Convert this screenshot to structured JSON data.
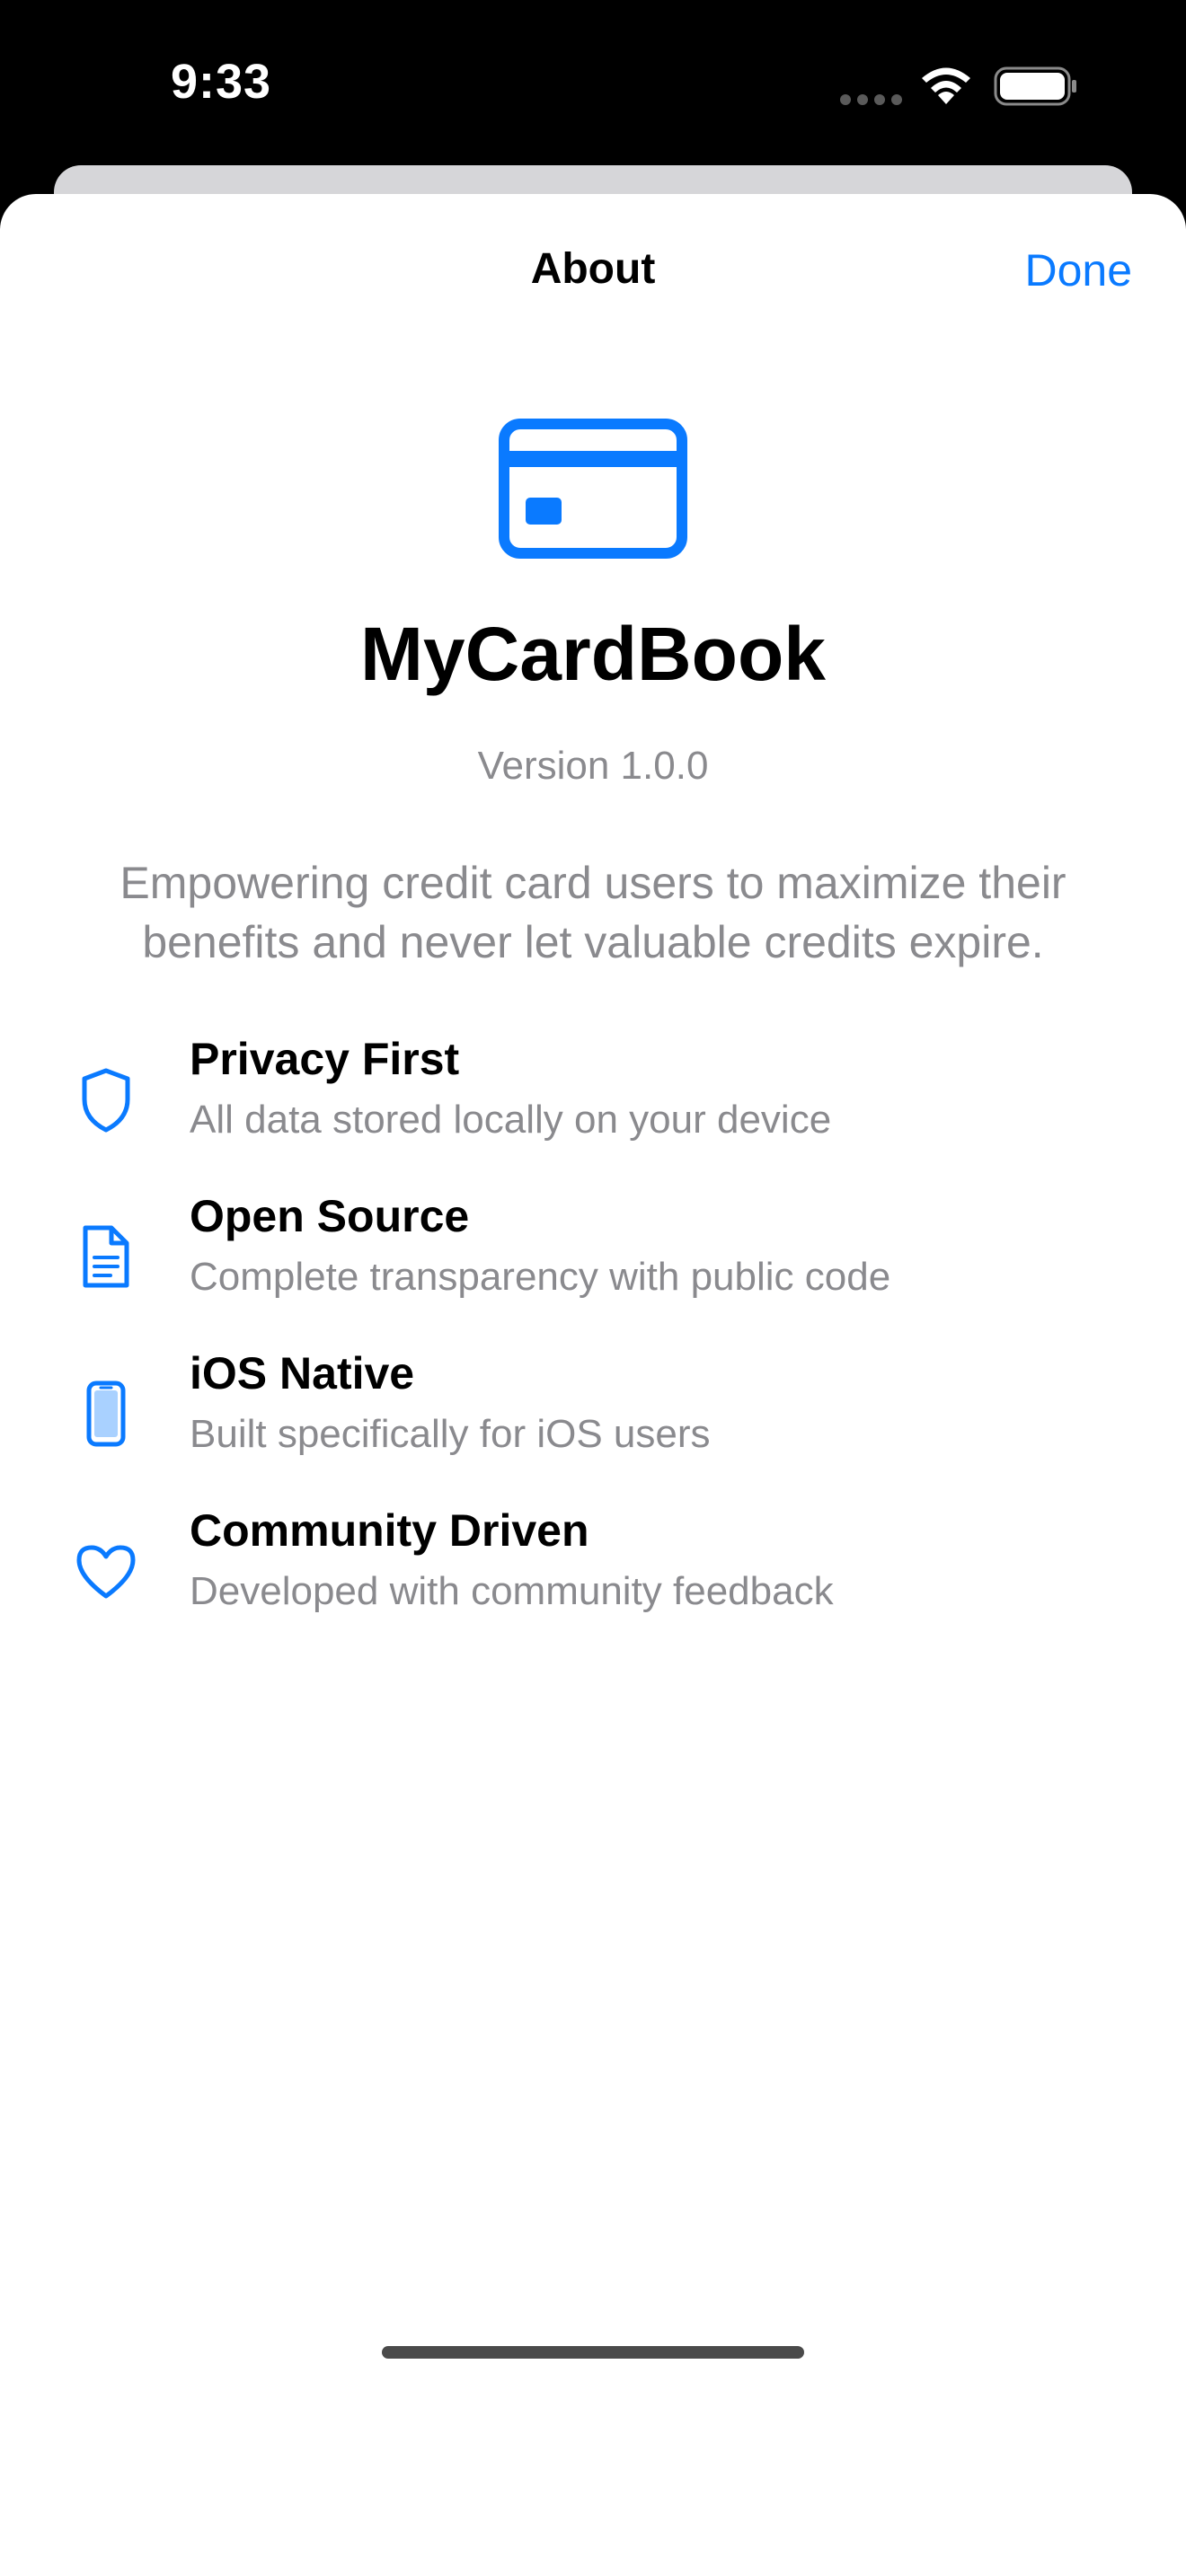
{
  "status_bar": {
    "time": "9:33"
  },
  "nav": {
    "title": "About",
    "done_label": "Done"
  },
  "app": {
    "icon": "credit-card-icon",
    "name": "MyCardBook",
    "version": "Version 1.0.0",
    "tagline": "Empowering credit card users to maximize their benefits and never let valuable credits expire."
  },
  "features": [
    {
      "icon": "shield-icon",
      "title": "Privacy First",
      "subtitle": "All data stored locally on your device"
    },
    {
      "icon": "document-icon",
      "title": "Open Source",
      "subtitle": "Complete transparency with public code"
    },
    {
      "icon": "iphone-icon",
      "title": "iOS Native",
      "subtitle": "Built specifically for iOS users"
    },
    {
      "icon": "heart-icon",
      "title": "Community Driven",
      "subtitle": "Developed with community feedback"
    }
  ],
  "colors": {
    "accent": "#0a7aff",
    "secondary_text": "#8a8a8e",
    "background": "#ffffff"
  }
}
